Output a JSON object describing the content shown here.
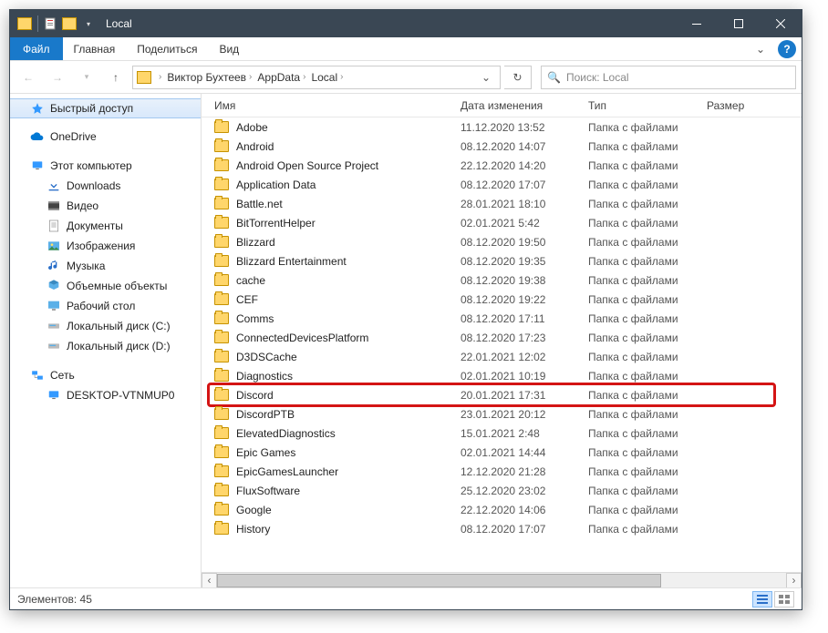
{
  "window": {
    "title": "Local"
  },
  "ribbon": {
    "file": "Файл",
    "tabs": [
      "Главная",
      "Поделиться",
      "Вид"
    ]
  },
  "breadcrumb": [
    "Виктор Бухтеев",
    "AppData",
    "Local"
  ],
  "search": {
    "placeholder": "Поиск: Local"
  },
  "sidebar": {
    "quickAccess": "Быстрый доступ",
    "oneDrive": "OneDrive",
    "thisPC": "Этот компьютер",
    "items": [
      "Downloads",
      "Видео",
      "Документы",
      "Изображения",
      "Музыка",
      "Объемные объекты",
      "Рабочий стол",
      "Локальный диск (C:)",
      "Локальный диск (D:)"
    ],
    "network": "Сеть",
    "networkItems": [
      "DESKTOP-VTNMUP0"
    ]
  },
  "columns": {
    "name": "Имя",
    "date": "Дата изменения",
    "type": "Тип",
    "size": "Размер"
  },
  "files": [
    {
      "name": "Adobe",
      "date": "11.12.2020 13:52",
      "type": "Папка с файлами"
    },
    {
      "name": "Android",
      "date": "08.12.2020 14:07",
      "type": "Папка с файлами"
    },
    {
      "name": "Android Open Source Project",
      "date": "22.12.2020 14:20",
      "type": "Папка с файлами"
    },
    {
      "name": "Application Data",
      "date": "08.12.2020 17:07",
      "type": "Папка с файлами"
    },
    {
      "name": "Battle.net",
      "date": "28.01.2021 18:10",
      "type": "Папка с файлами"
    },
    {
      "name": "BitTorrentHelper",
      "date": "02.01.2021 5:42",
      "type": "Папка с файлами"
    },
    {
      "name": "Blizzard",
      "date": "08.12.2020 19:50",
      "type": "Папка с файлами"
    },
    {
      "name": "Blizzard Entertainment",
      "date": "08.12.2020 19:35",
      "type": "Папка с файлами"
    },
    {
      "name": "cache",
      "date": "08.12.2020 19:38",
      "type": "Папка с файлами"
    },
    {
      "name": "CEF",
      "date": "08.12.2020 19:22",
      "type": "Папка с файлами"
    },
    {
      "name": "Comms",
      "date": "08.12.2020 17:11",
      "type": "Папка с файлами"
    },
    {
      "name": "ConnectedDevicesPlatform",
      "date": "08.12.2020 17:23",
      "type": "Папка с файлами"
    },
    {
      "name": "D3DSCache",
      "date": "22.01.2021 12:02",
      "type": "Папка с файлами"
    },
    {
      "name": "Diagnostics",
      "date": "02.01.2021 10:19",
      "type": "Папка с файлами"
    },
    {
      "name": "Discord",
      "date": "20.01.2021 17:31",
      "type": "Папка с файлами",
      "highlight": true
    },
    {
      "name": "DiscordPTB",
      "date": "23.01.2021 20:12",
      "type": "Папка с файлами"
    },
    {
      "name": "ElevatedDiagnostics",
      "date": "15.01.2021 2:48",
      "type": "Папка с файлами"
    },
    {
      "name": "Epic Games",
      "date": "02.01.2021 14:44",
      "type": "Папка с файлами"
    },
    {
      "name": "EpicGamesLauncher",
      "date": "12.12.2020 21:28",
      "type": "Папка с файлами"
    },
    {
      "name": "FluxSoftware",
      "date": "25.12.2020 23:02",
      "type": "Папка с файлами"
    },
    {
      "name": "Google",
      "date": "22.12.2020 14:06",
      "type": "Папка с файлами"
    },
    {
      "name": "History",
      "date": "08.12.2020 17:07",
      "type": "Папка с файлами"
    }
  ],
  "status": {
    "text": "Элементов: 45"
  }
}
